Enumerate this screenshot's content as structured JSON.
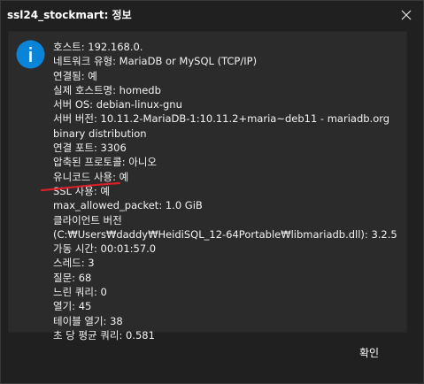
{
  "window": {
    "title": "ssl24_stockmart: 정보",
    "close_icon": "close-icon"
  },
  "message": {
    "icon": "info-icon",
    "icon_color": "#0a84d8",
    "lines": [
      "호스트: 192.168.0.",
      "네트워크 유형: MariaDB or MySQL (TCP/IP)",
      "연결됨: 예",
      "실제 호스트명: homedb",
      "서버 OS: debian-linux-gnu",
      "서버 버전: 10.11.2-MariaDB-1:10.11.2+maria~deb11 - mariadb.org",
      "binary distribution",
      "연결 포트: 3306",
      "압축된 프로토콜: 아니오",
      "유니코드 사용: 예",
      "SSL 사용: 예",
      "max_allowed_packet: 1.0 GiB",
      "클라이언트 버전",
      "(C:₩Users₩daddy₩HeidiSQL_12-64Portable₩libmariadb.dll): 3.2.5",
      "가동 시간: 00:01:57.0",
      "스레드: 3",
      "질문: 68",
      "느린 쿼리: 0",
      "열기: 45",
      "테이블 열기: 38",
      "초 당 평균 쿼리: 0.581"
    ],
    "annotation_color": "#d8202a"
  },
  "buttons": {
    "ok_label": "확인"
  }
}
